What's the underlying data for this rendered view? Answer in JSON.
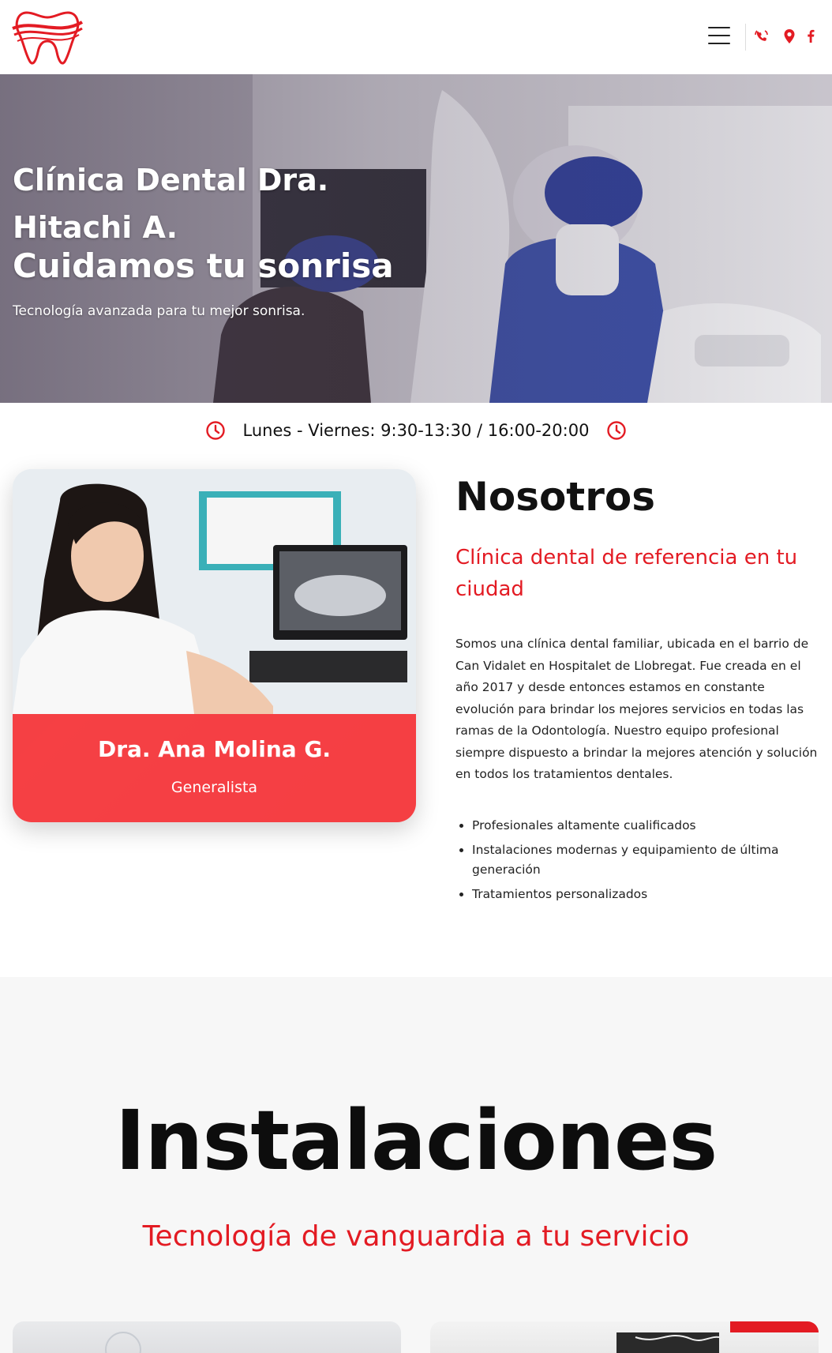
{
  "header": {
    "logo_alt": "",
    "menu_icon": "hamburger-menu-icon",
    "icons": [
      "phone-icon",
      "location-pin-icon",
      "facebook-icon"
    ]
  },
  "hero": {
    "title_line1": "Clínica Dental Dra.",
    "title_line2": "Hitachi A.",
    "subtitle": "Cuidamos tu sonrisa",
    "tagline": "Tecnología avanzada para tu mejor sonrisa."
  },
  "hours": {
    "text": "Lunes - Viernes: 9:30-13:30 / 16:00-20:00"
  },
  "doctor": {
    "name": "Dra. Ana Molina G.",
    "role": "Generalista"
  },
  "about": {
    "title": "Nosotros",
    "subtitle": "Clínica dental de referencia en tu ciudad",
    "body": "Somos una clínica dental familiar, ubicada en el barrio de Can Vidalet en Hospitalet de Llobregat. Fue creada en el año 2017 y desde entonces estamos en constante evolución para brindar los mejores servicios en todas las ramas de la Odontología. Nuestro equipo profesional siempre dispuesto a brindar la mejores atención y solución en todos los tratamientos dentales.",
    "features": [
      "Profesionales altamente cualificados",
      "Instalaciones modernas y equipamiento de última generación",
      "Tratamientos personalizados"
    ]
  },
  "facilities": {
    "title": "Instalaciones",
    "subtitle": "Tecnología de vanguardia a tu servicio"
  },
  "colors": {
    "accent": "#e31b23",
    "band": "#f53034",
    "section_bg": "#f7f7f7"
  }
}
